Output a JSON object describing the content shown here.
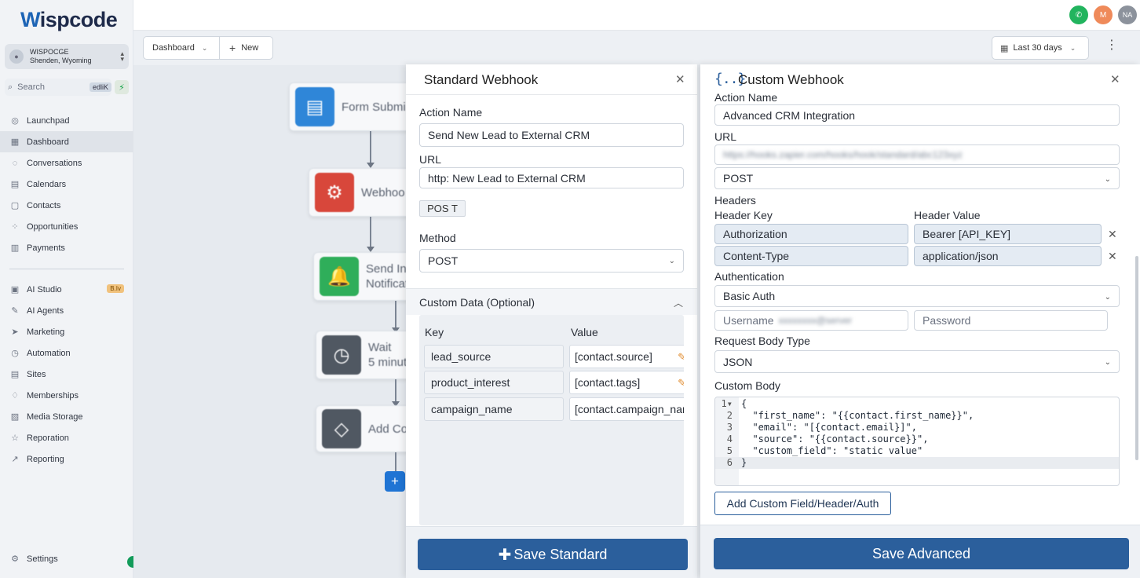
{
  "brand": {
    "logo_first": "W",
    "logo_rest": "ispcode"
  },
  "account": {
    "name": "WISPOCGE",
    "location": "Shenden, Wyoming"
  },
  "search": {
    "placeholder": "Search",
    "shortcut": "edliK"
  },
  "sidebar": {
    "items": [
      {
        "label": "Launchpad",
        "icon": "rocket-icon"
      },
      {
        "label": "Dashboard",
        "icon": "dashboard-icon",
        "active": true
      },
      {
        "label": "Conversations",
        "icon": "chat-icon"
      },
      {
        "label": "Calendars",
        "icon": "calendar-icon"
      },
      {
        "label": "Contacts",
        "icon": "contacts-icon"
      },
      {
        "label": "Opportunities",
        "icon": "opportunities-icon"
      },
      {
        "label": "Payments",
        "icon": "payments-icon"
      }
    ],
    "items2": [
      {
        "label": "AI Studio",
        "icon": "ai-studio-icon",
        "badge": "B.Iv"
      },
      {
        "label": "AI Agents",
        "icon": "ai-agents-icon"
      },
      {
        "label": "Marketing",
        "icon": "marketing-icon"
      },
      {
        "label": "Automation",
        "icon": "automation-icon"
      },
      {
        "label": "Sites",
        "icon": "sites-icon"
      },
      {
        "label": "Memberships",
        "icon": "memberships-icon"
      },
      {
        "label": "Media Storage",
        "icon": "media-icon"
      },
      {
        "label": "Reporation",
        "icon": "star-icon"
      },
      {
        "label": "Reporting",
        "icon": "reporting-icon"
      }
    ],
    "settings": "Settings"
  },
  "topbar": {
    "avatar_m": "M",
    "avatar_na": "NA"
  },
  "toolbar": {
    "dashboard": "Dashboard",
    "new": "New",
    "date_range": "Last 30 days"
  },
  "workflow": {
    "nodes": [
      {
        "label1": "Form Submi",
        "label2": "",
        "color": "#2f86d8",
        "icon": "form-icon"
      },
      {
        "label1": "Webhoo",
        "label2": "",
        "color": "#d8473b",
        "icon": "webhook-icon"
      },
      {
        "label1": "Send Int",
        "label2": "Notificati",
        "color": "#2fae5a",
        "icon": "bell-icon"
      },
      {
        "label1": "Wait",
        "label2": "5 minut",
        "color": "#505862",
        "icon": "clock-icon"
      },
      {
        "label1": "Add Co",
        "label2": "",
        "color": "#505862",
        "icon": "tag-icon"
      }
    ]
  },
  "standard": {
    "title": "Standard Webhook",
    "action_name_label": "Action Name",
    "action_name_value": "Send New Lead to External CRM",
    "url_label": "URL",
    "url_value": "http: New Lead to External CRM",
    "mini_button": "POS T",
    "method_label": "Method",
    "method_value": "POST",
    "custom_data_label": "Custom Data (Optional)",
    "key_header": "Key",
    "value_header": "Value",
    "rows": [
      {
        "key": "lead_source",
        "value": "[contact.source]"
      },
      {
        "key": "product_interest",
        "value": "[contact.tags]"
      },
      {
        "key": "campaign_name",
        "value": "[contact.campaign_name]"
      }
    ],
    "save_label": "Save Standard"
  },
  "custom": {
    "title": "Custom Webhook",
    "action_name_label": "Action Name",
    "action_name_value": "Advanced CRM Integration",
    "url_label": "URL",
    "url_value": "https://hooks.zapier.com/hooks/hook/standard/abc123xyz",
    "method_value": "POST",
    "headers_label": "Headers",
    "header_key_label": "Header Key",
    "header_value_label": "Header Value",
    "headers": [
      {
        "key": "Authorization",
        "value": "Bearer [API_KEY]"
      },
      {
        "key": "Content-Type",
        "value": "application/json"
      }
    ],
    "auth_label": "Authentication",
    "auth_value": "Basic Auth",
    "username_placeholder": "Username",
    "username_value": "xxxxxxxx@server",
    "password_placeholder": "Password",
    "body_type_label": "Request Body Type",
    "body_type_value": "JSON",
    "custom_body_label": "Custom Body",
    "code_lines": [
      "{",
      "  \"first_name\": \"{{contact.first_name}}\",",
      "  \"email\": \"[{contact.email}]\",",
      "  \"source\": \"{{contact.source}}\",",
      "  \"custom_field\": \"static value\"",
      "}"
    ],
    "add_button": "Add Custom Field/Header/Auth",
    "save_label": "Save Advanced"
  }
}
